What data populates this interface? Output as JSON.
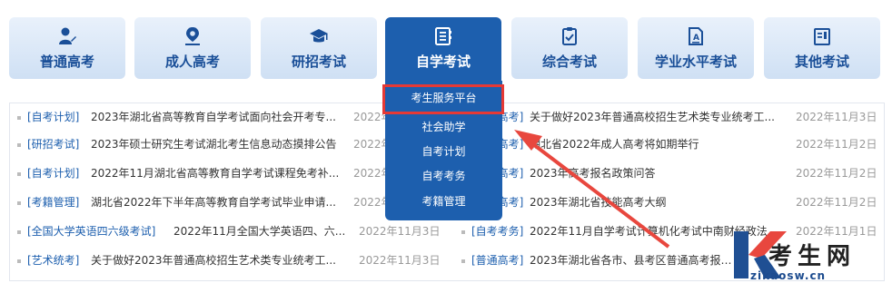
{
  "nav": {
    "items": [
      {
        "label": "普通高考",
        "icon": "user-pen-icon"
      },
      {
        "label": "成人高考",
        "icon": "location-pin-icon"
      },
      {
        "label": "研招考试",
        "icon": "graduation-cap-icon"
      },
      {
        "label": "自学考试",
        "icon": "notebook-icon"
      },
      {
        "label": "综合考试",
        "icon": "clipboard-check-icon"
      },
      {
        "label": "学业水平考试",
        "icon": "document-edit-icon"
      },
      {
        "label": "其他考试",
        "icon": "book-icon"
      }
    ],
    "active_index": 3
  },
  "dropdown": {
    "items": [
      "考生服务平台",
      "社会助学",
      "自考计划",
      "自考考务",
      "考籍管理"
    ],
    "highlighted_index": 0
  },
  "news": {
    "left": [
      {
        "tag": "[自考计划]",
        "title": "2023年湖北省高等教育自学考试面向社会开考专...",
        "date": "2022年11"
      },
      {
        "tag": "[研招考试]",
        "title": "2023年硕士研究生考试湖北考生信息动态摸排公告",
        "date": "2022年1"
      },
      {
        "tag": "[自考计划]",
        "title": "2022年11月湖北省高等教育自学考试课程免考补...",
        "date": "2022年"
      },
      {
        "tag": "[考籍管理]",
        "title": "湖北省2022年下半年高等教育自学考试毕业申请...",
        "date": "2022年"
      },
      {
        "tag": "[全国大学英语四六级考试]",
        "title": "2022年11月全国大学英语四、六...",
        "date": "2022年11月3日"
      },
      {
        "tag": "[艺术统考]",
        "title": "关于做好2023年普通高校招生艺术类专业统考工...",
        "date": "2022年11月3日"
      }
    ],
    "right": [
      {
        "tag": "[普通高考]",
        "title": "关于做好2023年普通高校招生艺术类专业统考工...",
        "date": "2022年11月3日"
      },
      {
        "tag": "[成人高考]",
        "title": "湖北省2022年成人高考将如期举行",
        "date": "2022年11月2日"
      },
      {
        "tag": "[普通高考]",
        "title": "2023年高考报名政策问答",
        "date": "2022年11月2日"
      },
      {
        "tag": "[普通高考]",
        "title": "2023年湖北省技能高考大纲",
        "date": "2022年11月2日"
      },
      {
        "tag": "[自考考务]",
        "title": "2022年11月自学考试计算机化考试中南财经政法...",
        "date": "2022年11月1日"
      },
      {
        "tag": "[普通高考]",
        "title": "2023年湖北省各市、县考区普通高考报名咨询电...",
        "date": ""
      }
    ]
  },
  "watermark": {
    "name": "考生网",
    "url": "zikaosw.cn"
  },
  "colors": {
    "accent": "#1d5fae",
    "highlight_box": "#e53935",
    "tag_link": "#1d5fae"
  }
}
